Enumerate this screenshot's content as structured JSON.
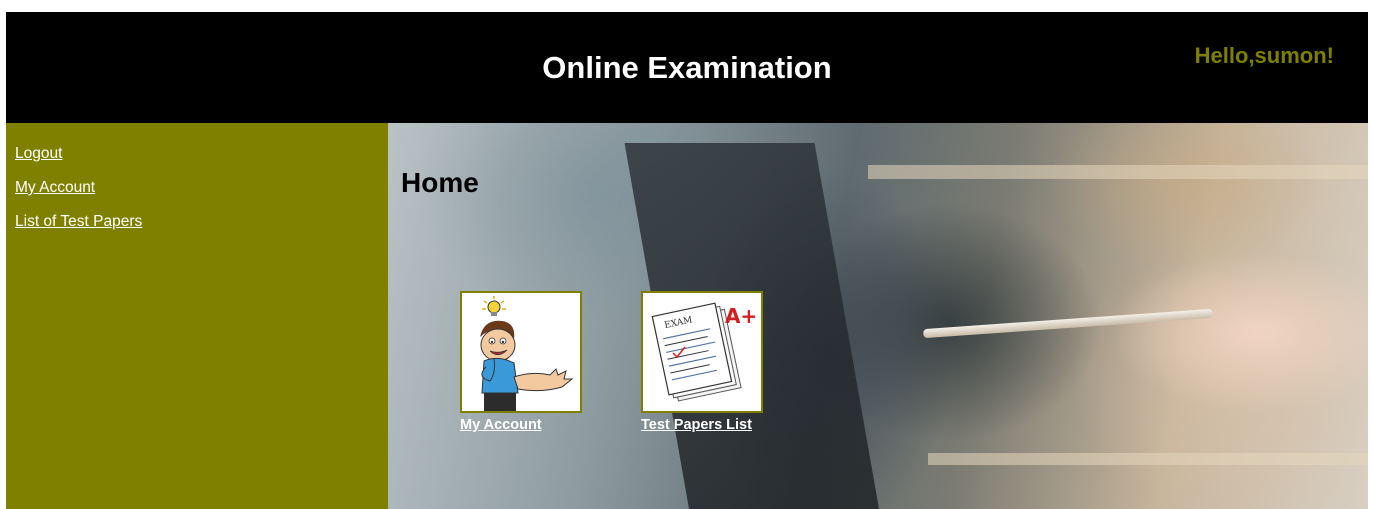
{
  "header": {
    "title": "Online Examination",
    "greeting": "Hello,sumon!"
  },
  "sidebar": {
    "items": [
      {
        "label": "Logout"
      },
      {
        "label": "My Account"
      },
      {
        "label": "List of Test Papers"
      }
    ]
  },
  "main": {
    "heading": "Home",
    "tiles": [
      {
        "label": "My Account",
        "icon": "cartoon-person-icon"
      },
      {
        "label": "Test Papers List",
        "icon": "exam-paper-icon"
      }
    ]
  },
  "colors": {
    "header_bg": "#000000",
    "sidebar_bg": "#808000",
    "accent": "#808000",
    "link": "#ffffff"
  }
}
